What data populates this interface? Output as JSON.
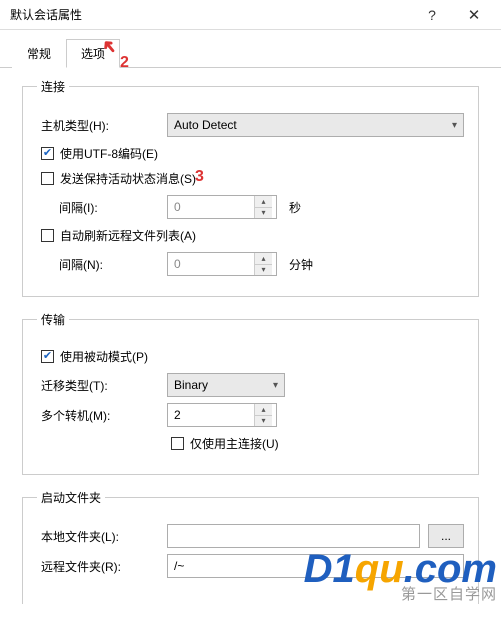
{
  "window": {
    "title": "默认会话属性"
  },
  "tabs": {
    "general": "常规",
    "options": "选项"
  },
  "annotations": {
    "num2": "2",
    "num3": "3"
  },
  "connect": {
    "legend": "连接",
    "host_type_label": "主机类型(H):",
    "host_type_value": "Auto Detect",
    "utf8_label": "使用UTF-8编码(E)",
    "keepalive_label": "发送保持活动状态消息(S)",
    "interval1_label": "间隔(I):",
    "interval1_value": "0",
    "interval1_unit": "秒",
    "autorefresh_label": "自动刷新远程文件列表(A)",
    "interval2_label": "间隔(N):",
    "interval2_value": "0",
    "interval2_unit": "分钟"
  },
  "transfer": {
    "legend": "传输",
    "passive_label": "使用被动模式(P)",
    "type_label": "迁移类型(T):",
    "type_value": "Binary",
    "multi_label": "多个转机(M):",
    "multi_value": "2",
    "mainconn_label": "仅使用主连接(U)"
  },
  "startup": {
    "legend": "启动文件夹",
    "local_label": "本地文件夹(L):",
    "local_value": "",
    "remote_label": "远程文件夹(R):",
    "remote_value": "/~",
    "browse": "..."
  },
  "watermark": {
    "line1a": "D1",
    "line1b": "qu",
    "line1c": ".com",
    "line2": "第一区自学网"
  }
}
